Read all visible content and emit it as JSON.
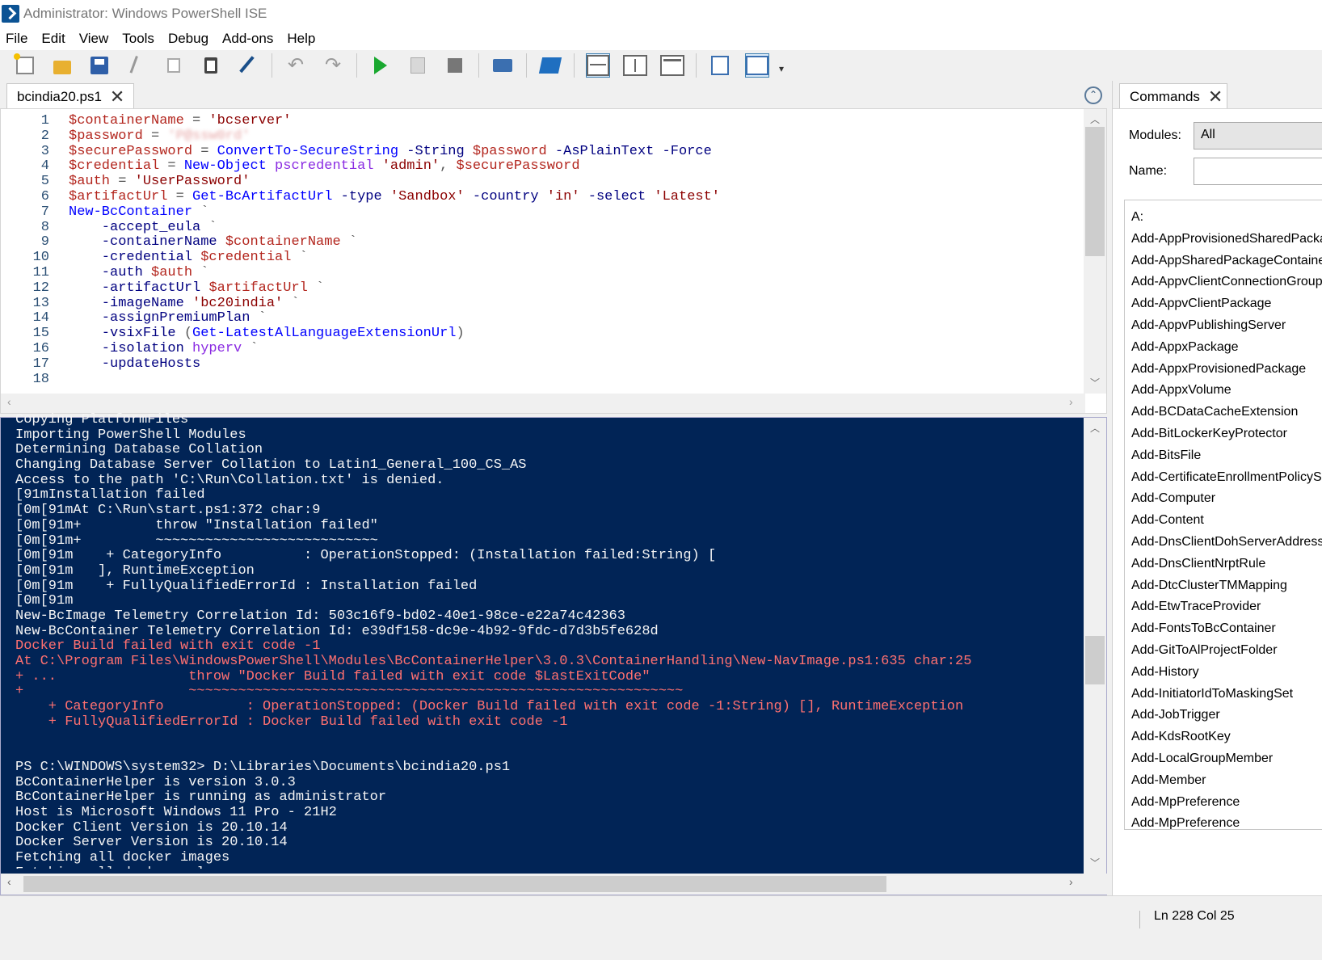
{
  "window": {
    "title": "Administrator: Windows PowerShell ISE"
  },
  "menu": [
    "File",
    "Edit",
    "View",
    "Tools",
    "Debug",
    "Add-ons",
    "Help"
  ],
  "toolbar_icons": [
    "new-script-icon",
    "open-icon",
    "save-icon",
    "cut-icon",
    "copy-icon",
    "paste-icon",
    "clear-console-icon",
    "undo-icon",
    "redo-icon",
    "run-icon",
    "run-selection-icon",
    "stop-icon",
    "remote-powershell-icon",
    "powershell-icon",
    "script-pane-top-icon",
    "script-pane-right-icon",
    "script-pane-max-icon",
    "show-command-window-icon",
    "show-command-addon-icon"
  ],
  "script_tab": {
    "label": "bcindia20.ps1"
  },
  "editor": {
    "line_numbers": [
      "1",
      "2",
      "3",
      "4",
      "5",
      "6",
      "7",
      "8",
      "9",
      "10",
      "11",
      "12",
      "13",
      "14",
      "15",
      "16",
      "17",
      "18"
    ],
    "lines": [
      [
        {
          "t": "$containerName",
          "c": "vv"
        },
        {
          "t": " = ",
          "c": "op"
        },
        {
          "t": "'bcserver'",
          "c": "str"
        }
      ],
      [
        {
          "t": "$password",
          "c": "vv"
        },
        {
          "t": " = ",
          "c": "op"
        },
        {
          "t": "'P@ssw0rd'",
          "c": "blur"
        }
      ],
      [
        {
          "t": "$securePassword",
          "c": "vv"
        },
        {
          "t": " = ",
          "c": "op"
        },
        {
          "t": "ConvertTo-SecureString",
          "c": "cmdlet"
        },
        {
          "t": " -String ",
          "c": "param"
        },
        {
          "t": "$password",
          "c": "vv"
        },
        {
          "t": " -AsPlainText -Force",
          "c": "param"
        }
      ],
      [
        {
          "t": "$credential",
          "c": "vv"
        },
        {
          "t": " = ",
          "c": "op"
        },
        {
          "t": "New-Object",
          "c": "cmdlet"
        },
        {
          "t": " pscredential ",
          "c": "arg"
        },
        {
          "t": "'admin'",
          "c": "str"
        },
        {
          "t": ", ",
          "c": "op"
        },
        {
          "t": "$securePassword",
          "c": "vv"
        }
      ],
      [
        {
          "t": "$auth",
          "c": "vv"
        },
        {
          "t": " = ",
          "c": "op"
        },
        {
          "t": "'UserPassword'",
          "c": "str"
        }
      ],
      [
        {
          "t": "$artifactUrl",
          "c": "vv"
        },
        {
          "t": " = ",
          "c": "op"
        },
        {
          "t": "Get-BcArtifactUrl",
          "c": "cmdlet"
        },
        {
          "t": " -type ",
          "c": "param"
        },
        {
          "t": "'Sandbox'",
          "c": "str"
        },
        {
          "t": " -country ",
          "c": "param"
        },
        {
          "t": "'in'",
          "c": "str"
        },
        {
          "t": " -select ",
          "c": "param"
        },
        {
          "t": "'Latest'",
          "c": "str"
        }
      ],
      [
        {
          "t": "New-BcContainer",
          "c": "cmdlet"
        },
        {
          "t": " `",
          "c": "op"
        }
      ],
      [
        {
          "t": "    -accept_eula",
          "c": "param"
        },
        {
          "t": " `",
          "c": "op"
        }
      ],
      [
        {
          "t": "    -containerName ",
          "c": "param"
        },
        {
          "t": "$containerName",
          "c": "vv"
        },
        {
          "t": " `",
          "c": "op"
        }
      ],
      [
        {
          "t": "    -credential ",
          "c": "param"
        },
        {
          "t": "$credential",
          "c": "vv"
        },
        {
          "t": " `",
          "c": "op"
        }
      ],
      [
        {
          "t": "    -auth ",
          "c": "param"
        },
        {
          "t": "$auth",
          "c": "vv"
        },
        {
          "t": " `",
          "c": "op"
        }
      ],
      [
        {
          "t": "    -artifactUrl ",
          "c": "param"
        },
        {
          "t": "$artifactUrl",
          "c": "vv"
        },
        {
          "t": " `",
          "c": "op"
        }
      ],
      [
        {
          "t": "    -imageName ",
          "c": "param"
        },
        {
          "t": "'bc20india'",
          "c": "str"
        },
        {
          "t": " `",
          "c": "op"
        }
      ],
      [
        {
          "t": "    -assignPremiumPlan",
          "c": "param"
        },
        {
          "t": " `",
          "c": "op"
        }
      ],
      [
        {
          "t": "    -vsixFile ",
          "c": "param"
        },
        {
          "t": "(",
          "c": "op"
        },
        {
          "t": "Get-LatestAlLanguageExtensionUrl",
          "c": "cmdlet"
        },
        {
          "t": ")",
          "c": "op"
        }
      ],
      [
        {
          "t": "    -isolation ",
          "c": "param"
        },
        {
          "t": "hyperv",
          "c": "arg"
        },
        {
          "t": " `",
          "c": "op"
        }
      ],
      [
        {
          "t": "    -updateHosts",
          "c": "param"
        }
      ],
      [
        {
          "t": "",
          "c": "op"
        }
      ]
    ]
  },
  "console": {
    "lines": [
      {
        "t": "Copying PlatformFiles",
        "err": false
      },
      {
        "t": "Importing PowerShell Modules",
        "err": false
      },
      {
        "t": "Determining Database Collation",
        "err": false
      },
      {
        "t": "Changing Database Server Collation to Latin1_General_100_CS_AS",
        "err": false
      },
      {
        "t": "Access to the path 'C:\\Run\\Collation.txt' is denied.",
        "err": false
      },
      {
        "t": "[91mInstallation failed",
        "err": false
      },
      {
        "t": "[0m[91mAt C:\\Run\\start.ps1:372 char:9",
        "err": false
      },
      {
        "t": "[0m[91m+         throw \"Installation failed\"",
        "err": false
      },
      {
        "t": "[0m[91m+         ~~~~~~~~~~~~~~~~~~~~~~~~~~~",
        "err": false
      },
      {
        "t": "[0m[91m    + CategoryInfo          : OperationStopped: (Installation failed:String) [",
        "err": false
      },
      {
        "t": "[0m[91m   ], RuntimeException",
        "err": false
      },
      {
        "t": "[0m[91m    + FullyQualifiedErrorId : Installation failed",
        "err": false
      },
      {
        "t": "[0m[91m",
        "err": false
      },
      {
        "t": "New-BcImage Telemetry Correlation Id: 503c16f9-bd02-40e1-98ce-e22a74c42363",
        "err": false
      },
      {
        "t": "New-BcContainer Telemetry Correlation Id: e39df158-dc9e-4b92-9fdc-d7d3b5fe628d",
        "err": false
      },
      {
        "t": "Docker Build failed with exit code -1",
        "err": true
      },
      {
        "t": "At C:\\Program Files\\WindowsPowerShell\\Modules\\BcContainerHelper\\3.0.3\\ContainerHandling\\New-NavImage.ps1:635 char:25",
        "err": true
      },
      {
        "t": "+ ...                throw \"Docker Build failed with exit code $LastExitCode\"",
        "err": true
      },
      {
        "t": "+                    ~~~~~~~~~~~~~~~~~~~~~~~~~~~~~~~~~~~~~~~~~~~~~~~~~~~~~~~~~~~~",
        "err": true
      },
      {
        "t": "    + CategoryInfo          : OperationStopped: (Docker Build failed with exit code -1:String) [], RuntimeException",
        "err": true
      },
      {
        "t": "    + FullyQualifiedErrorId : Docker Build failed with exit code -1",
        "err": true
      },
      {
        "t": "",
        "err": false
      },
      {
        "t": "",
        "err": false
      },
      {
        "t": "PS C:\\WINDOWS\\system32> D:\\Libraries\\Documents\\bcindia20.ps1",
        "err": false
      },
      {
        "t": "BcContainerHelper is version 3.0.3",
        "err": false
      },
      {
        "t": "BcContainerHelper is running as administrator",
        "err": false
      },
      {
        "t": "Host is Microsoft Windows 11 Pro - 21H2",
        "err": false
      },
      {
        "t": "Docker Client Version is 20.10.14",
        "err": false
      },
      {
        "t": "Docker Server Version is 20.10.14",
        "err": false
      },
      {
        "t": "Fetching all docker images",
        "err": false
      },
      {
        "t": "Fetching all docker volumes",
        "err": false
      }
    ]
  },
  "commands_pane": {
    "tab_label": "Commands",
    "modules_label": "Modules:",
    "modules_value": "All",
    "name_label": "Name:",
    "items": [
      "A:",
      "Add-AppProvisionedSharedPackageContainer",
      "Add-AppSharedPackageContainer",
      "Add-AppvClientConnectionGroup",
      "Add-AppvClientPackage",
      "Add-AppvPublishingServer",
      "Add-AppxPackage",
      "Add-AppxProvisionedPackage",
      "Add-AppxVolume",
      "Add-BCDataCacheExtension",
      "Add-BitLockerKeyProtector",
      "Add-BitsFile",
      "Add-CertificateEnrollmentPolicyServer",
      "Add-Computer",
      "Add-Content",
      "Add-DnsClientDohServerAddress",
      "Add-DnsClientNrptRule",
      "Add-DtcClusterTMMapping",
      "Add-EtwTraceProvider",
      "Add-FontsToBcContainer",
      "Add-GitToAlProjectFolder",
      "Add-History",
      "Add-InitiatorIdToMaskingSet",
      "Add-JobTrigger",
      "Add-KdsRootKey",
      "Add-LocalGroupMember",
      "Add-Member",
      "Add-MpPreference",
      "Add-MpPreference"
    ]
  },
  "status": {
    "position": "Ln 228  Col 25"
  }
}
